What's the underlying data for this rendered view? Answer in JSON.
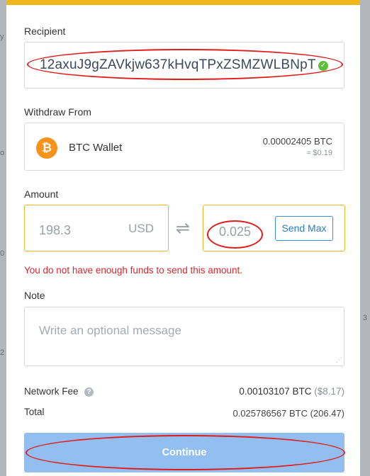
{
  "background": {
    "ticks": [
      "y",
      "o",
      "0",
      "2",
      "3"
    ]
  },
  "colors": {
    "accent_top": "#f2b619",
    "error": "#d6292b",
    "link_blue": "#2a7dc9",
    "continue_bg": "#92bff0",
    "bitcoin": "#f7931a",
    "valid": "#5fbd3b",
    "annotation": "#e01b1b"
  },
  "recipient": {
    "label": "Recipient",
    "address": "12axuJ9gZAVkjw637kHvqTPxZSMZWLBNpT",
    "valid_icon": "check-circle-icon"
  },
  "withdraw_from": {
    "label": "Withdraw From",
    "wallet_icon": "bitcoin-icon",
    "wallet_icon_glyph": "₿",
    "wallet_name": "BTC Wallet",
    "balance": "0.00002405 BTC",
    "balance_fiat": "≈ $0.19"
  },
  "amount": {
    "label": "Amount",
    "usd_value": "198.3",
    "usd_unit": "USD",
    "swap_icon": "swap-arrows-icon",
    "btc_value": "0.025",
    "send_max_label": "Send Max",
    "error": "You do not have enough funds to send this amount."
  },
  "note": {
    "label": "Note",
    "placeholder": "Write an optional message"
  },
  "summary": {
    "network_fee_label": "Network Fee",
    "network_fee_btc": "0.00103107 BTC",
    "network_fee_fiat": "($8.17)",
    "total_label": "Total",
    "total_value": "0.025786567 BTC (206.47)"
  },
  "actions": {
    "continue_label": "Continue"
  }
}
